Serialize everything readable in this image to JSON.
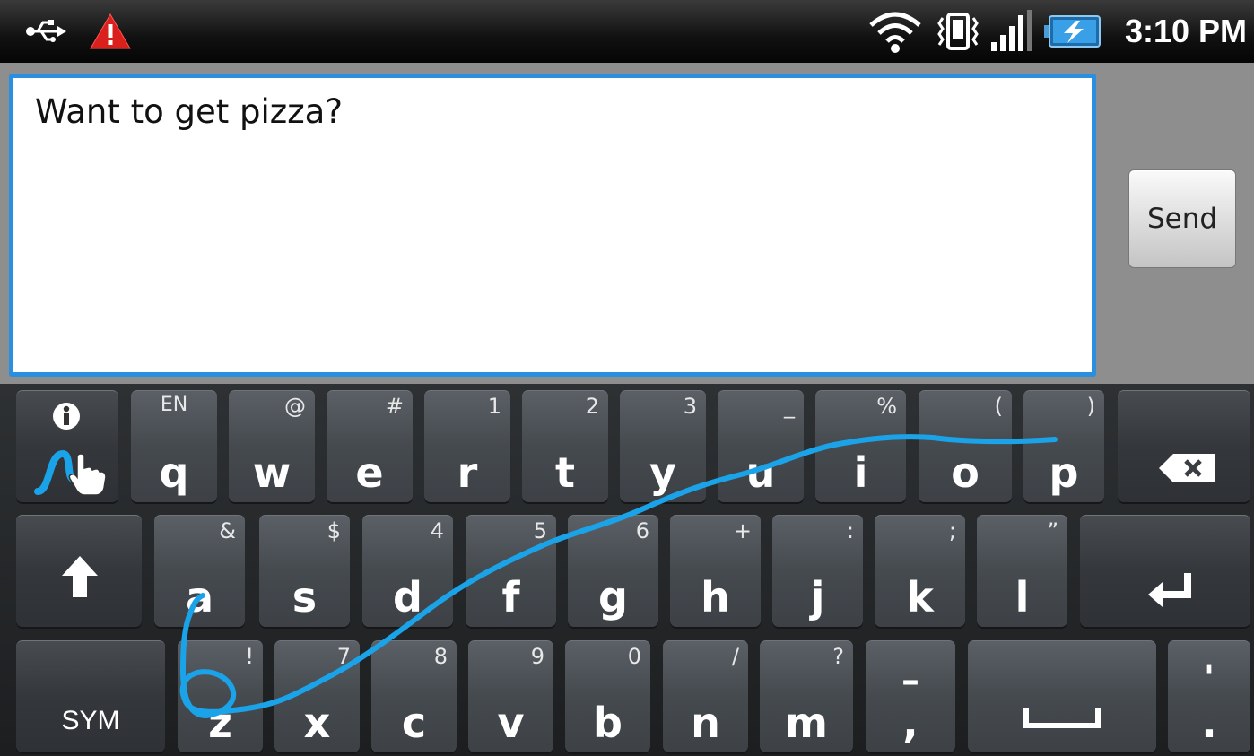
{
  "status_bar": {
    "time": "3:10 PM",
    "icons": [
      "usb-icon",
      "warning-icon",
      "wifi-icon",
      "vibrate-icon",
      "signal-icon",
      "battery-charging-icon"
    ]
  },
  "compose": {
    "message_text": "Want to get pizza?",
    "send_label": "Send"
  },
  "keyboard": {
    "row1": [
      {
        "main": "q",
        "alt": "EN"
      },
      {
        "main": "w",
        "alt": "@"
      },
      {
        "main": "e",
        "alt": "#"
      },
      {
        "main": "r",
        "alt": "1"
      },
      {
        "main": "t",
        "alt": "2"
      },
      {
        "main": "y",
        "alt": "3"
      },
      {
        "main": "u",
        "alt": "_"
      },
      {
        "main": "i",
        "alt": "%"
      },
      {
        "main": "o",
        "alt": "("
      },
      {
        "main": "p",
        "alt": ")"
      }
    ],
    "row2": [
      {
        "main": "a",
        "alt": "&"
      },
      {
        "main": "s",
        "alt": "$"
      },
      {
        "main": "d",
        "alt": "4"
      },
      {
        "main": "f",
        "alt": "5"
      },
      {
        "main": "g",
        "alt": "6"
      },
      {
        "main": "h",
        "alt": "+"
      },
      {
        "main": "j",
        "alt": ":"
      },
      {
        "main": "k",
        "alt": ";"
      },
      {
        "main": "l",
        "alt": "”"
      }
    ],
    "row3": [
      {
        "main": "z",
        "alt": "!"
      },
      {
        "main": "x",
        "alt": "7"
      },
      {
        "main": "c",
        "alt": "8"
      },
      {
        "main": "v",
        "alt": "9"
      },
      {
        "main": "b",
        "alt": "0"
      },
      {
        "main": "n",
        "alt": "/"
      },
      {
        "main": "m",
        "alt": "?"
      }
    ],
    "sym_label": "SYM",
    "dash_alt": "–",
    "comma_main": ",",
    "apostrophe_alt": "'",
    "period_main": "."
  },
  "colors": {
    "accent": "#2a8fe0",
    "trace": "#1aa3e8",
    "key_fill": "#4a4f54",
    "keyboard_bg": "#222426"
  }
}
